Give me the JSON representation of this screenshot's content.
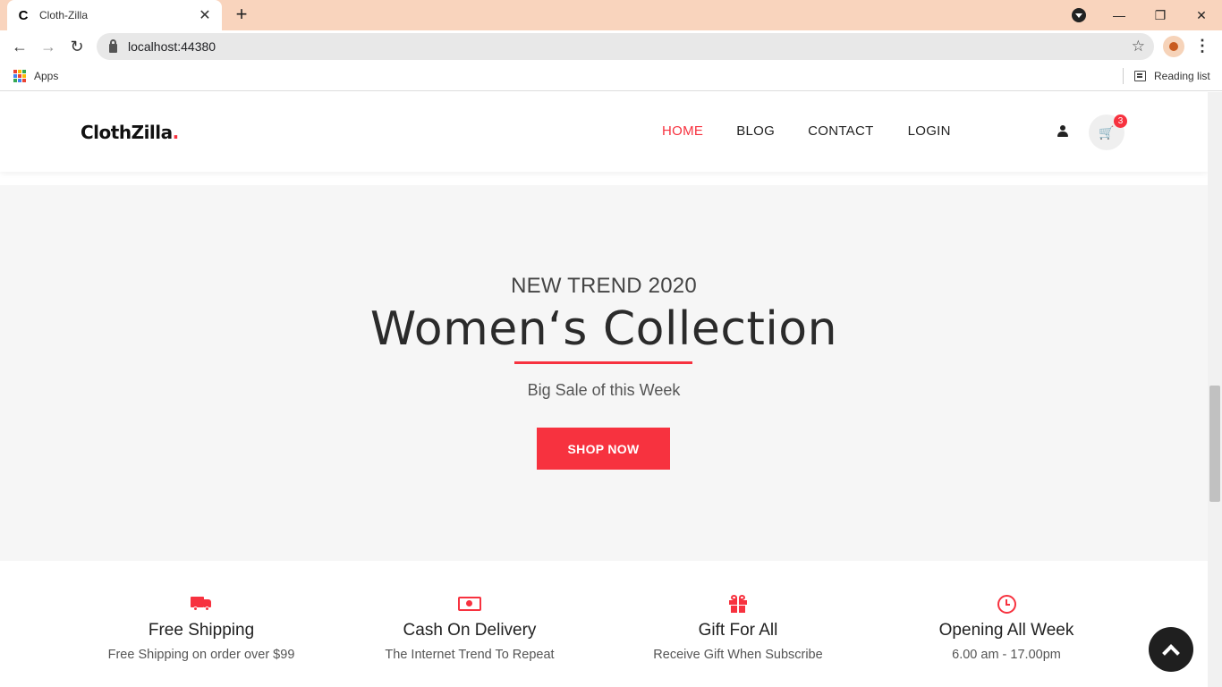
{
  "browser": {
    "tab_title": "Cloth-Zilla",
    "tab_favicon": "C",
    "tab_close": "✕",
    "new_tab": "+",
    "url": "localhost:44380",
    "bookmarks_apps": "Apps",
    "reading_list": "Reading list",
    "minimize": "—",
    "restore": "❐",
    "close": "✕"
  },
  "site": {
    "logo_text": "ClothZilla",
    "logo_dot": ".",
    "nav": [
      {
        "label": "HOME",
        "active": true
      },
      {
        "label": "BLOG"
      },
      {
        "label": "CONTACT"
      },
      {
        "label": "LOGIN"
      }
    ],
    "cart_count": "3"
  },
  "hero": {
    "kicker": "NEW TREND 2020",
    "title": "Women‘s Collection",
    "subtitle": "Big Sale of this Week",
    "button": "SHOP NOW"
  },
  "features": [
    {
      "icon": "truck-icon",
      "title": "Free Shipping",
      "desc": "Free Shipping on order over $99"
    },
    {
      "icon": "money-icon",
      "title": "Cash On Delivery",
      "desc": "The Internet Trend To Repeat"
    },
    {
      "icon": "gift-icon",
      "title": "Gift For All",
      "desc": "Receive Gift When Subscribe"
    },
    {
      "icon": "clock-icon",
      "title": "Opening All Week",
      "desc": "6.00 am - 17.00pm"
    }
  ],
  "colors": {
    "accent": "#f7323f",
    "tabbar": "#f9d4bd",
    "hero_bg": "#f6f6f6"
  }
}
